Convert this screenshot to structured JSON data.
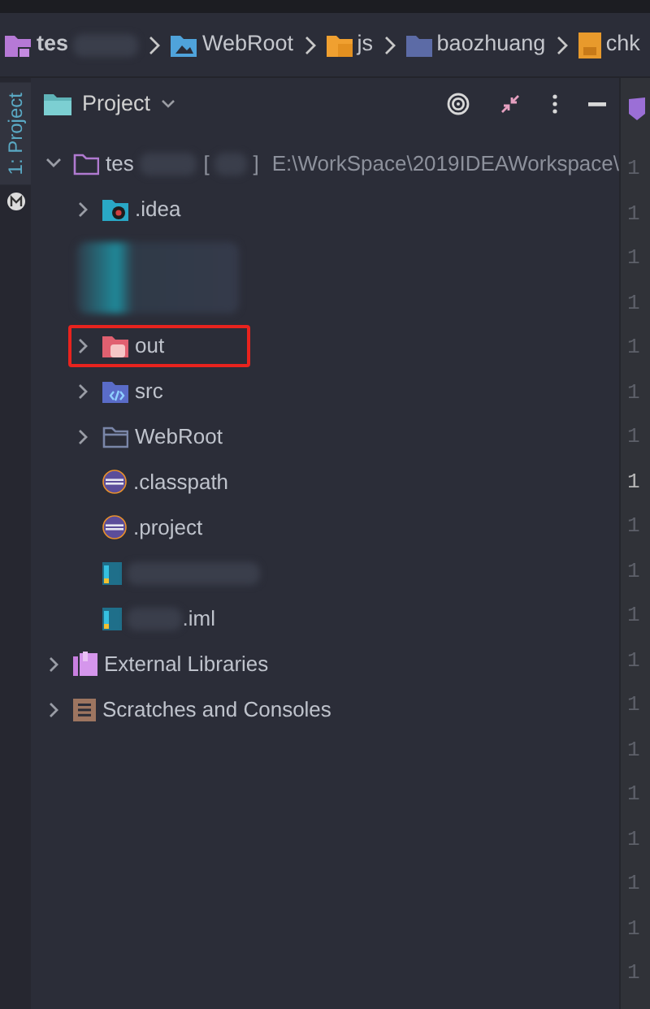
{
  "breadcrumb": [
    {
      "label": "tes",
      "kind": "module",
      "redacted": true
    },
    {
      "label": "WebRoot",
      "kind": "web-folder"
    },
    {
      "label": "js",
      "kind": "js-folder"
    },
    {
      "label": "baozhuang",
      "kind": "folder"
    },
    {
      "label": "chk",
      "kind": "js-file"
    }
  ],
  "side_tabs": [
    {
      "label": "1: Project",
      "selected": true
    }
  ],
  "panel": {
    "title": "Project"
  },
  "tree": [
    {
      "kind": "module",
      "label": "tes",
      "tag_open": "[",
      "tag_close": "]",
      "path": "E:\\WorkSpace\\2019IDEAWorkspace\\",
      "expanded": true,
      "children": [
        {
          "kind": "folder-idea",
          "label": ".idea",
          "expanded": false
        },
        {
          "kind": "redacted"
        },
        {
          "kind": "folder-excluded",
          "label": "out",
          "expanded": false,
          "highlighted": true
        },
        {
          "kind": "folder-source",
          "label": "src",
          "expanded": false
        },
        {
          "kind": "folder",
          "label": "WebRoot",
          "expanded": false
        },
        {
          "kind": "eclipse-file",
          "label": ".classpath"
        },
        {
          "kind": "eclipse-file",
          "label": ".project"
        },
        {
          "kind": "iml-file",
          "redacted": true
        },
        {
          "kind": "iml-file",
          "label": ".iml",
          "redacted": true
        }
      ]
    },
    {
      "kind": "libraries",
      "label": "External Libraries",
      "expanded": false
    },
    {
      "kind": "scratches",
      "label": "Scratches and Consoles",
      "expanded": false
    }
  ],
  "gutter": [
    {
      "label": "1",
      "current": false
    },
    {
      "label": "1",
      "current": false
    },
    {
      "label": "1",
      "current": false
    },
    {
      "label": "1",
      "current": false
    },
    {
      "label": "1",
      "current": false
    },
    {
      "label": "1",
      "current": false
    },
    {
      "label": "1",
      "current": false
    },
    {
      "label": "1",
      "current": true
    },
    {
      "label": "1",
      "current": false
    },
    {
      "label": "1",
      "current": false
    },
    {
      "label": "1",
      "current": false
    },
    {
      "label": "1",
      "current": false
    },
    {
      "label": "1",
      "current": false
    },
    {
      "label": "1",
      "current": false
    },
    {
      "label": "1",
      "current": false
    },
    {
      "label": "1",
      "current": false
    },
    {
      "label": "1",
      "current": false
    },
    {
      "label": "1",
      "current": false
    },
    {
      "label": "1",
      "current": false
    }
  ]
}
